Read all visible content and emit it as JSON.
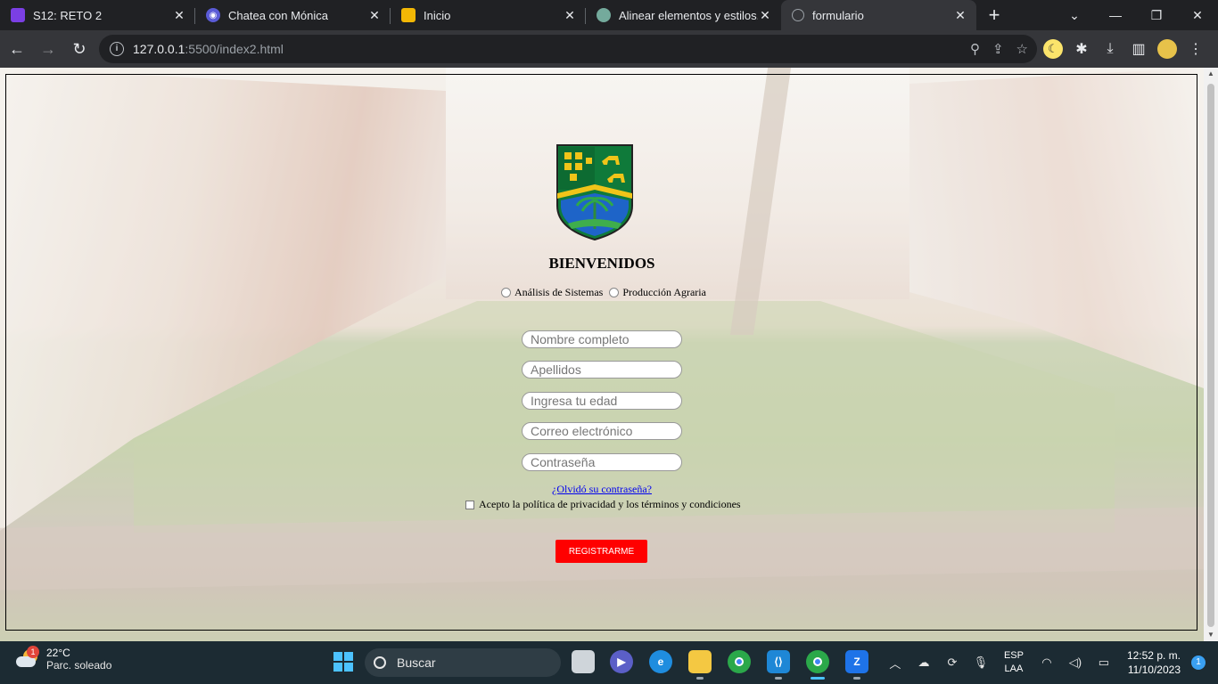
{
  "browser": {
    "tabs": [
      {
        "title": "S12: RETO 2",
        "favicon": "purple-square-icon",
        "color": "#7b3fe4"
      },
      {
        "title": "Chatea con Mónica",
        "favicon": "monica-bot-icon",
        "color": "#5a5bd6"
      },
      {
        "title": "Inicio",
        "favicon": "yellow-square-icon",
        "color": "#f2b705"
      },
      {
        "title": "Alinear elementos y estilos.",
        "favicon": "chatgpt-icon",
        "color": "#74aa9c"
      },
      {
        "title": "formulario",
        "favicon": "globe-icon",
        "color": "#9aa0a6"
      }
    ],
    "url_host": "127.0.0.1",
    "url_path": ":5500/index2.html"
  },
  "form": {
    "welcome": "BIENVENIDOS",
    "radio_options": [
      "Análisis de Sistemas",
      "Producción Agraria"
    ],
    "fields": [
      {
        "placeholder": "Nombre completo"
      },
      {
        "placeholder": "Apellidos"
      },
      {
        "placeholder": "Ingresa tu edad"
      },
      {
        "placeholder": "Correo electrónico"
      },
      {
        "placeholder": "Contraseña"
      }
    ],
    "forgot_link": "¿Olvidó su contraseña?",
    "terms_label": "Acepto la política de privacidad y los términos y condiciones",
    "submit_label": "REGISTRARME",
    "submit_color": "#ff0000"
  },
  "taskbar": {
    "weather_temp": "22°C",
    "weather_desc": "Parc. soleado",
    "weather_badge": "1",
    "search_label": "Buscar",
    "lang_top": "ESP",
    "lang_bottom": "LAA",
    "time": "12:52 p. m.",
    "date": "11/10/2023",
    "notif_count": "1"
  }
}
